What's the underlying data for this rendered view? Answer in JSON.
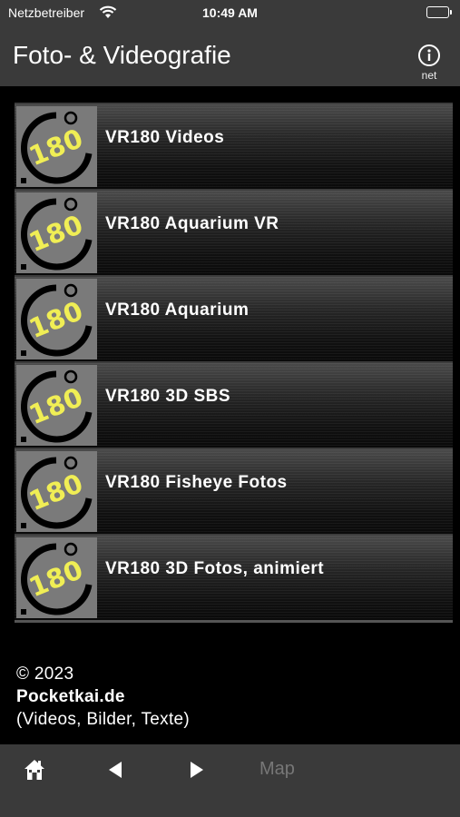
{
  "status_bar": {
    "carrier": "Netzbetreiber",
    "time": "10:49 AM",
    "wifi_icon": "wifi-icon",
    "battery_icon": "battery-icon"
  },
  "nav": {
    "title": "Foto- & Videografie",
    "info_label": "net",
    "info_icon": "info-circle-icon"
  },
  "list": {
    "thumb_text": "180",
    "items": [
      {
        "label": "VR180 Videos"
      },
      {
        "label": "VR180 Aquarium VR"
      },
      {
        "label": "VR180 Aquarium"
      },
      {
        "label": "VR180 3D SBS"
      },
      {
        "label": "VR180 Fisheye Fotos"
      },
      {
        "label": "VR180 3D Fotos, animiert"
      }
    ]
  },
  "footer": {
    "copyright": "© 2023",
    "site": "Pocketkai.de",
    "note": "(Videos, Bilder, Texte)"
  },
  "toolbar": {
    "home_icon": "home-icon",
    "back_icon": "back-arrow-icon",
    "forward_icon": "forward-arrow-icon",
    "map_label": "Map"
  },
  "colors": {
    "bar_bg": "#3a3a3a",
    "thumb_bg": "#7a7a7a",
    "thumb_text": "#f0ee55",
    "disabled": "#777777"
  }
}
